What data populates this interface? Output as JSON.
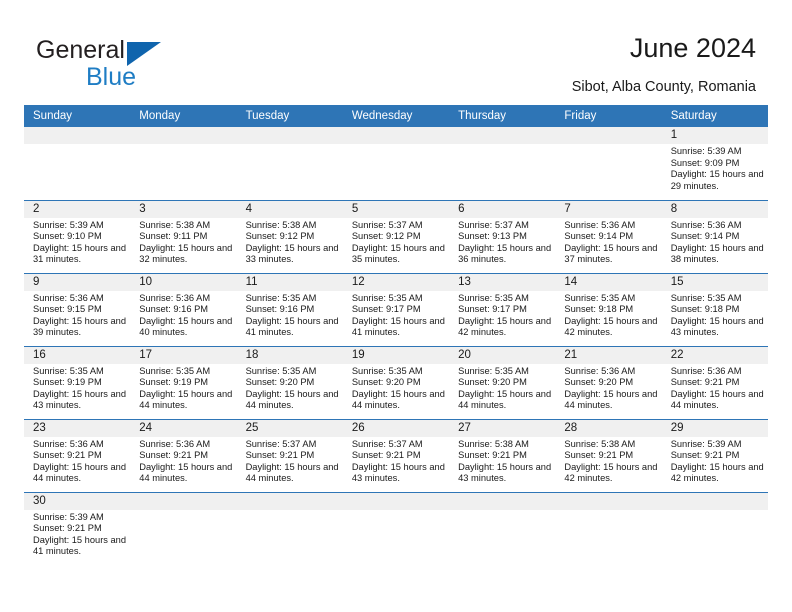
{
  "brand": {
    "name_top": "General",
    "name_bottom": "Blue",
    "triangle_color": "#0f64ad",
    "blue_color": "#1f7dc4"
  },
  "header": {
    "title": "June 2024",
    "subtitle": "Sibot, Alba County, Romania"
  },
  "theme": {
    "header_blue": "#2e75b6",
    "daynum_band": "#f0f0f0",
    "text": "#1a1a1a"
  },
  "weekday_headers": [
    "Sunday",
    "Monday",
    "Tuesday",
    "Wednesday",
    "Thursday",
    "Friday",
    "Saturday"
  ],
  "labels": {
    "sunrise": "Sunrise:",
    "sunset": "Sunset:",
    "daylight": "Daylight:"
  },
  "weeks": [
    [
      {
        "day": "",
        "empty": true
      },
      {
        "day": "",
        "empty": true
      },
      {
        "day": "",
        "empty": true
      },
      {
        "day": "",
        "empty": true
      },
      {
        "day": "",
        "empty": true
      },
      {
        "day": "",
        "empty": true
      },
      {
        "day": "1",
        "sunrise": "Sunrise: 5:39 AM",
        "sunset": "Sunset: 9:09 PM",
        "daylight": "Daylight: 15 hours and 29 minutes."
      }
    ],
    [
      {
        "day": "2",
        "sunrise": "Sunrise: 5:39 AM",
        "sunset": "Sunset: 9:10 PM",
        "daylight": "Daylight: 15 hours and 31 minutes."
      },
      {
        "day": "3",
        "sunrise": "Sunrise: 5:38 AM",
        "sunset": "Sunset: 9:11 PM",
        "daylight": "Daylight: 15 hours and 32 minutes."
      },
      {
        "day": "4",
        "sunrise": "Sunrise: 5:38 AM",
        "sunset": "Sunset: 9:12 PM",
        "daylight": "Daylight: 15 hours and 33 minutes."
      },
      {
        "day": "5",
        "sunrise": "Sunrise: 5:37 AM",
        "sunset": "Sunset: 9:12 PM",
        "daylight": "Daylight: 15 hours and 35 minutes."
      },
      {
        "day": "6",
        "sunrise": "Sunrise: 5:37 AM",
        "sunset": "Sunset: 9:13 PM",
        "daylight": "Daylight: 15 hours and 36 minutes."
      },
      {
        "day": "7",
        "sunrise": "Sunrise: 5:36 AM",
        "sunset": "Sunset: 9:14 PM",
        "daylight": "Daylight: 15 hours and 37 minutes."
      },
      {
        "day": "8",
        "sunrise": "Sunrise: 5:36 AM",
        "sunset": "Sunset: 9:14 PM",
        "daylight": "Daylight: 15 hours and 38 minutes."
      }
    ],
    [
      {
        "day": "9",
        "sunrise": "Sunrise: 5:36 AM",
        "sunset": "Sunset: 9:15 PM",
        "daylight": "Daylight: 15 hours and 39 minutes."
      },
      {
        "day": "10",
        "sunrise": "Sunrise: 5:36 AM",
        "sunset": "Sunset: 9:16 PM",
        "daylight": "Daylight: 15 hours and 40 minutes."
      },
      {
        "day": "11",
        "sunrise": "Sunrise: 5:35 AM",
        "sunset": "Sunset: 9:16 PM",
        "daylight": "Daylight: 15 hours and 41 minutes."
      },
      {
        "day": "12",
        "sunrise": "Sunrise: 5:35 AM",
        "sunset": "Sunset: 9:17 PM",
        "daylight": "Daylight: 15 hours and 41 minutes."
      },
      {
        "day": "13",
        "sunrise": "Sunrise: 5:35 AM",
        "sunset": "Sunset: 9:17 PM",
        "daylight": "Daylight: 15 hours and 42 minutes."
      },
      {
        "day": "14",
        "sunrise": "Sunrise: 5:35 AM",
        "sunset": "Sunset: 9:18 PM",
        "daylight": "Daylight: 15 hours and 42 minutes."
      },
      {
        "day": "15",
        "sunrise": "Sunrise: 5:35 AM",
        "sunset": "Sunset: 9:18 PM",
        "daylight": "Daylight: 15 hours and 43 minutes."
      }
    ],
    [
      {
        "day": "16",
        "sunrise": "Sunrise: 5:35 AM",
        "sunset": "Sunset: 9:19 PM",
        "daylight": "Daylight: 15 hours and 43 minutes."
      },
      {
        "day": "17",
        "sunrise": "Sunrise: 5:35 AM",
        "sunset": "Sunset: 9:19 PM",
        "daylight": "Daylight: 15 hours and 44 minutes."
      },
      {
        "day": "18",
        "sunrise": "Sunrise: 5:35 AM",
        "sunset": "Sunset: 9:20 PM",
        "daylight": "Daylight: 15 hours and 44 minutes."
      },
      {
        "day": "19",
        "sunrise": "Sunrise: 5:35 AM",
        "sunset": "Sunset: 9:20 PM",
        "daylight": "Daylight: 15 hours and 44 minutes."
      },
      {
        "day": "20",
        "sunrise": "Sunrise: 5:35 AM",
        "sunset": "Sunset: 9:20 PM",
        "daylight": "Daylight: 15 hours and 44 minutes."
      },
      {
        "day": "21",
        "sunrise": "Sunrise: 5:36 AM",
        "sunset": "Sunset: 9:20 PM",
        "daylight": "Daylight: 15 hours and 44 minutes."
      },
      {
        "day": "22",
        "sunrise": "Sunrise: 5:36 AM",
        "sunset": "Sunset: 9:21 PM",
        "daylight": "Daylight: 15 hours and 44 minutes."
      }
    ],
    [
      {
        "day": "23",
        "sunrise": "Sunrise: 5:36 AM",
        "sunset": "Sunset: 9:21 PM",
        "daylight": "Daylight: 15 hours and 44 minutes."
      },
      {
        "day": "24",
        "sunrise": "Sunrise: 5:36 AM",
        "sunset": "Sunset: 9:21 PM",
        "daylight": "Daylight: 15 hours and 44 minutes."
      },
      {
        "day": "25",
        "sunrise": "Sunrise: 5:37 AM",
        "sunset": "Sunset: 9:21 PM",
        "daylight": "Daylight: 15 hours and 44 minutes."
      },
      {
        "day": "26",
        "sunrise": "Sunrise: 5:37 AM",
        "sunset": "Sunset: 9:21 PM",
        "daylight": "Daylight: 15 hours and 43 minutes."
      },
      {
        "day": "27",
        "sunrise": "Sunrise: 5:38 AM",
        "sunset": "Sunset: 9:21 PM",
        "daylight": "Daylight: 15 hours and 43 minutes."
      },
      {
        "day": "28",
        "sunrise": "Sunrise: 5:38 AM",
        "sunset": "Sunset: 9:21 PM",
        "daylight": "Daylight: 15 hours and 42 minutes."
      },
      {
        "day": "29",
        "sunrise": "Sunrise: 5:39 AM",
        "sunset": "Sunset: 9:21 PM",
        "daylight": "Daylight: 15 hours and 42 minutes."
      }
    ],
    [
      {
        "day": "30",
        "sunrise": "Sunrise: 5:39 AM",
        "sunset": "Sunset: 9:21 PM",
        "daylight": "Daylight: 15 hours and 41 minutes."
      },
      {
        "day": "",
        "empty": true
      },
      {
        "day": "",
        "empty": true
      },
      {
        "day": "",
        "empty": true
      },
      {
        "day": "",
        "empty": true
      },
      {
        "day": "",
        "empty": true
      },
      {
        "day": "",
        "empty": true
      }
    ]
  ]
}
